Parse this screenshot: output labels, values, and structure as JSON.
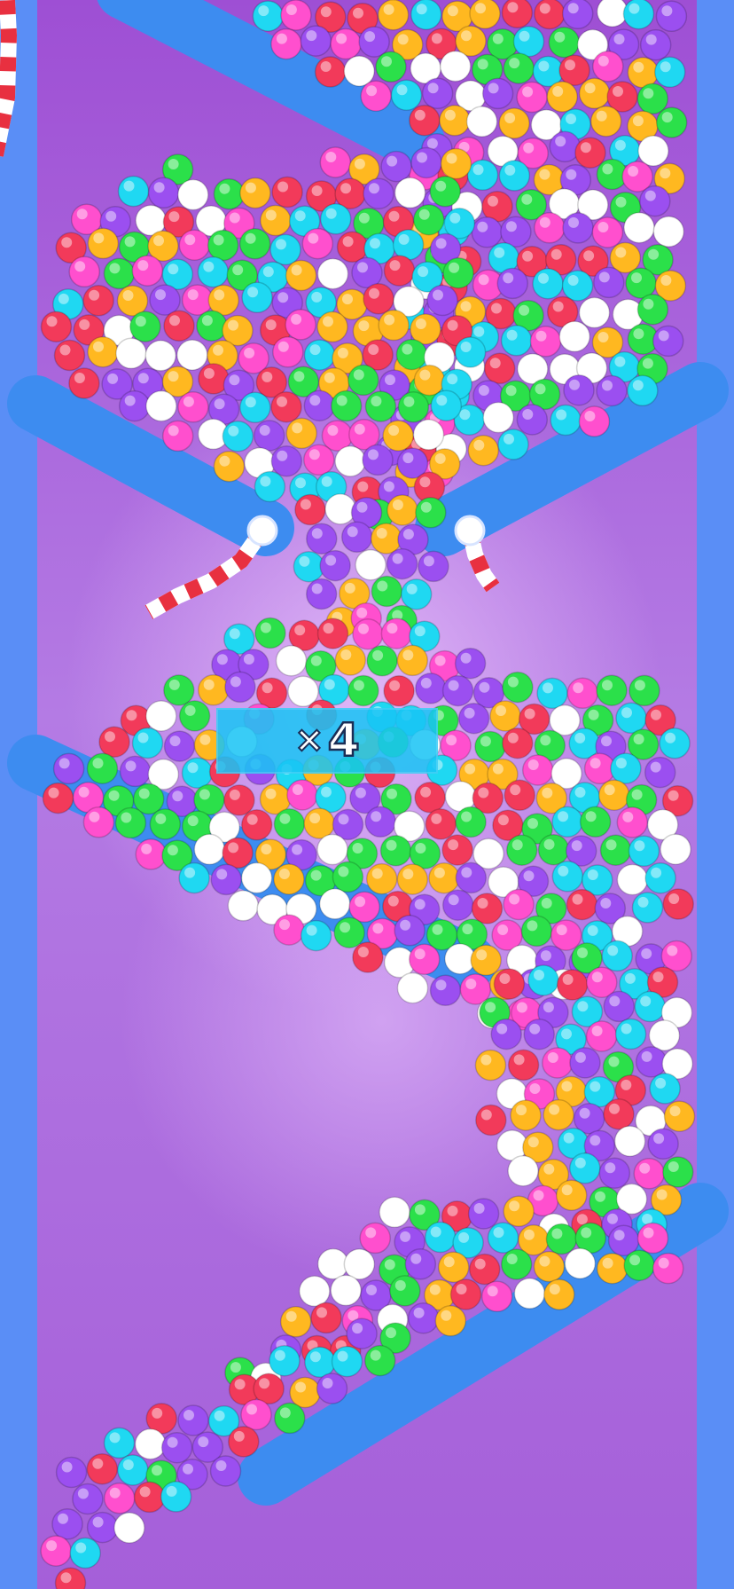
{
  "game": {
    "multiplier": {
      "prefix": "×",
      "value": "4"
    }
  },
  "colors": {
    "wall": "#5a8ef6",
    "ramp": "#3d8cf0",
    "peg": "#ffffff",
    "stripe_red": "#e83040",
    "stripe_white": "#ffffff",
    "multiplier_bg": "#18c4f4",
    "balls": [
      "#f23a5a",
      "#2be04a",
      "#ffb820",
      "#ff4fce",
      "#9b4ff0",
      "#ffffff",
      "#1fd8f2"
    ]
  }
}
